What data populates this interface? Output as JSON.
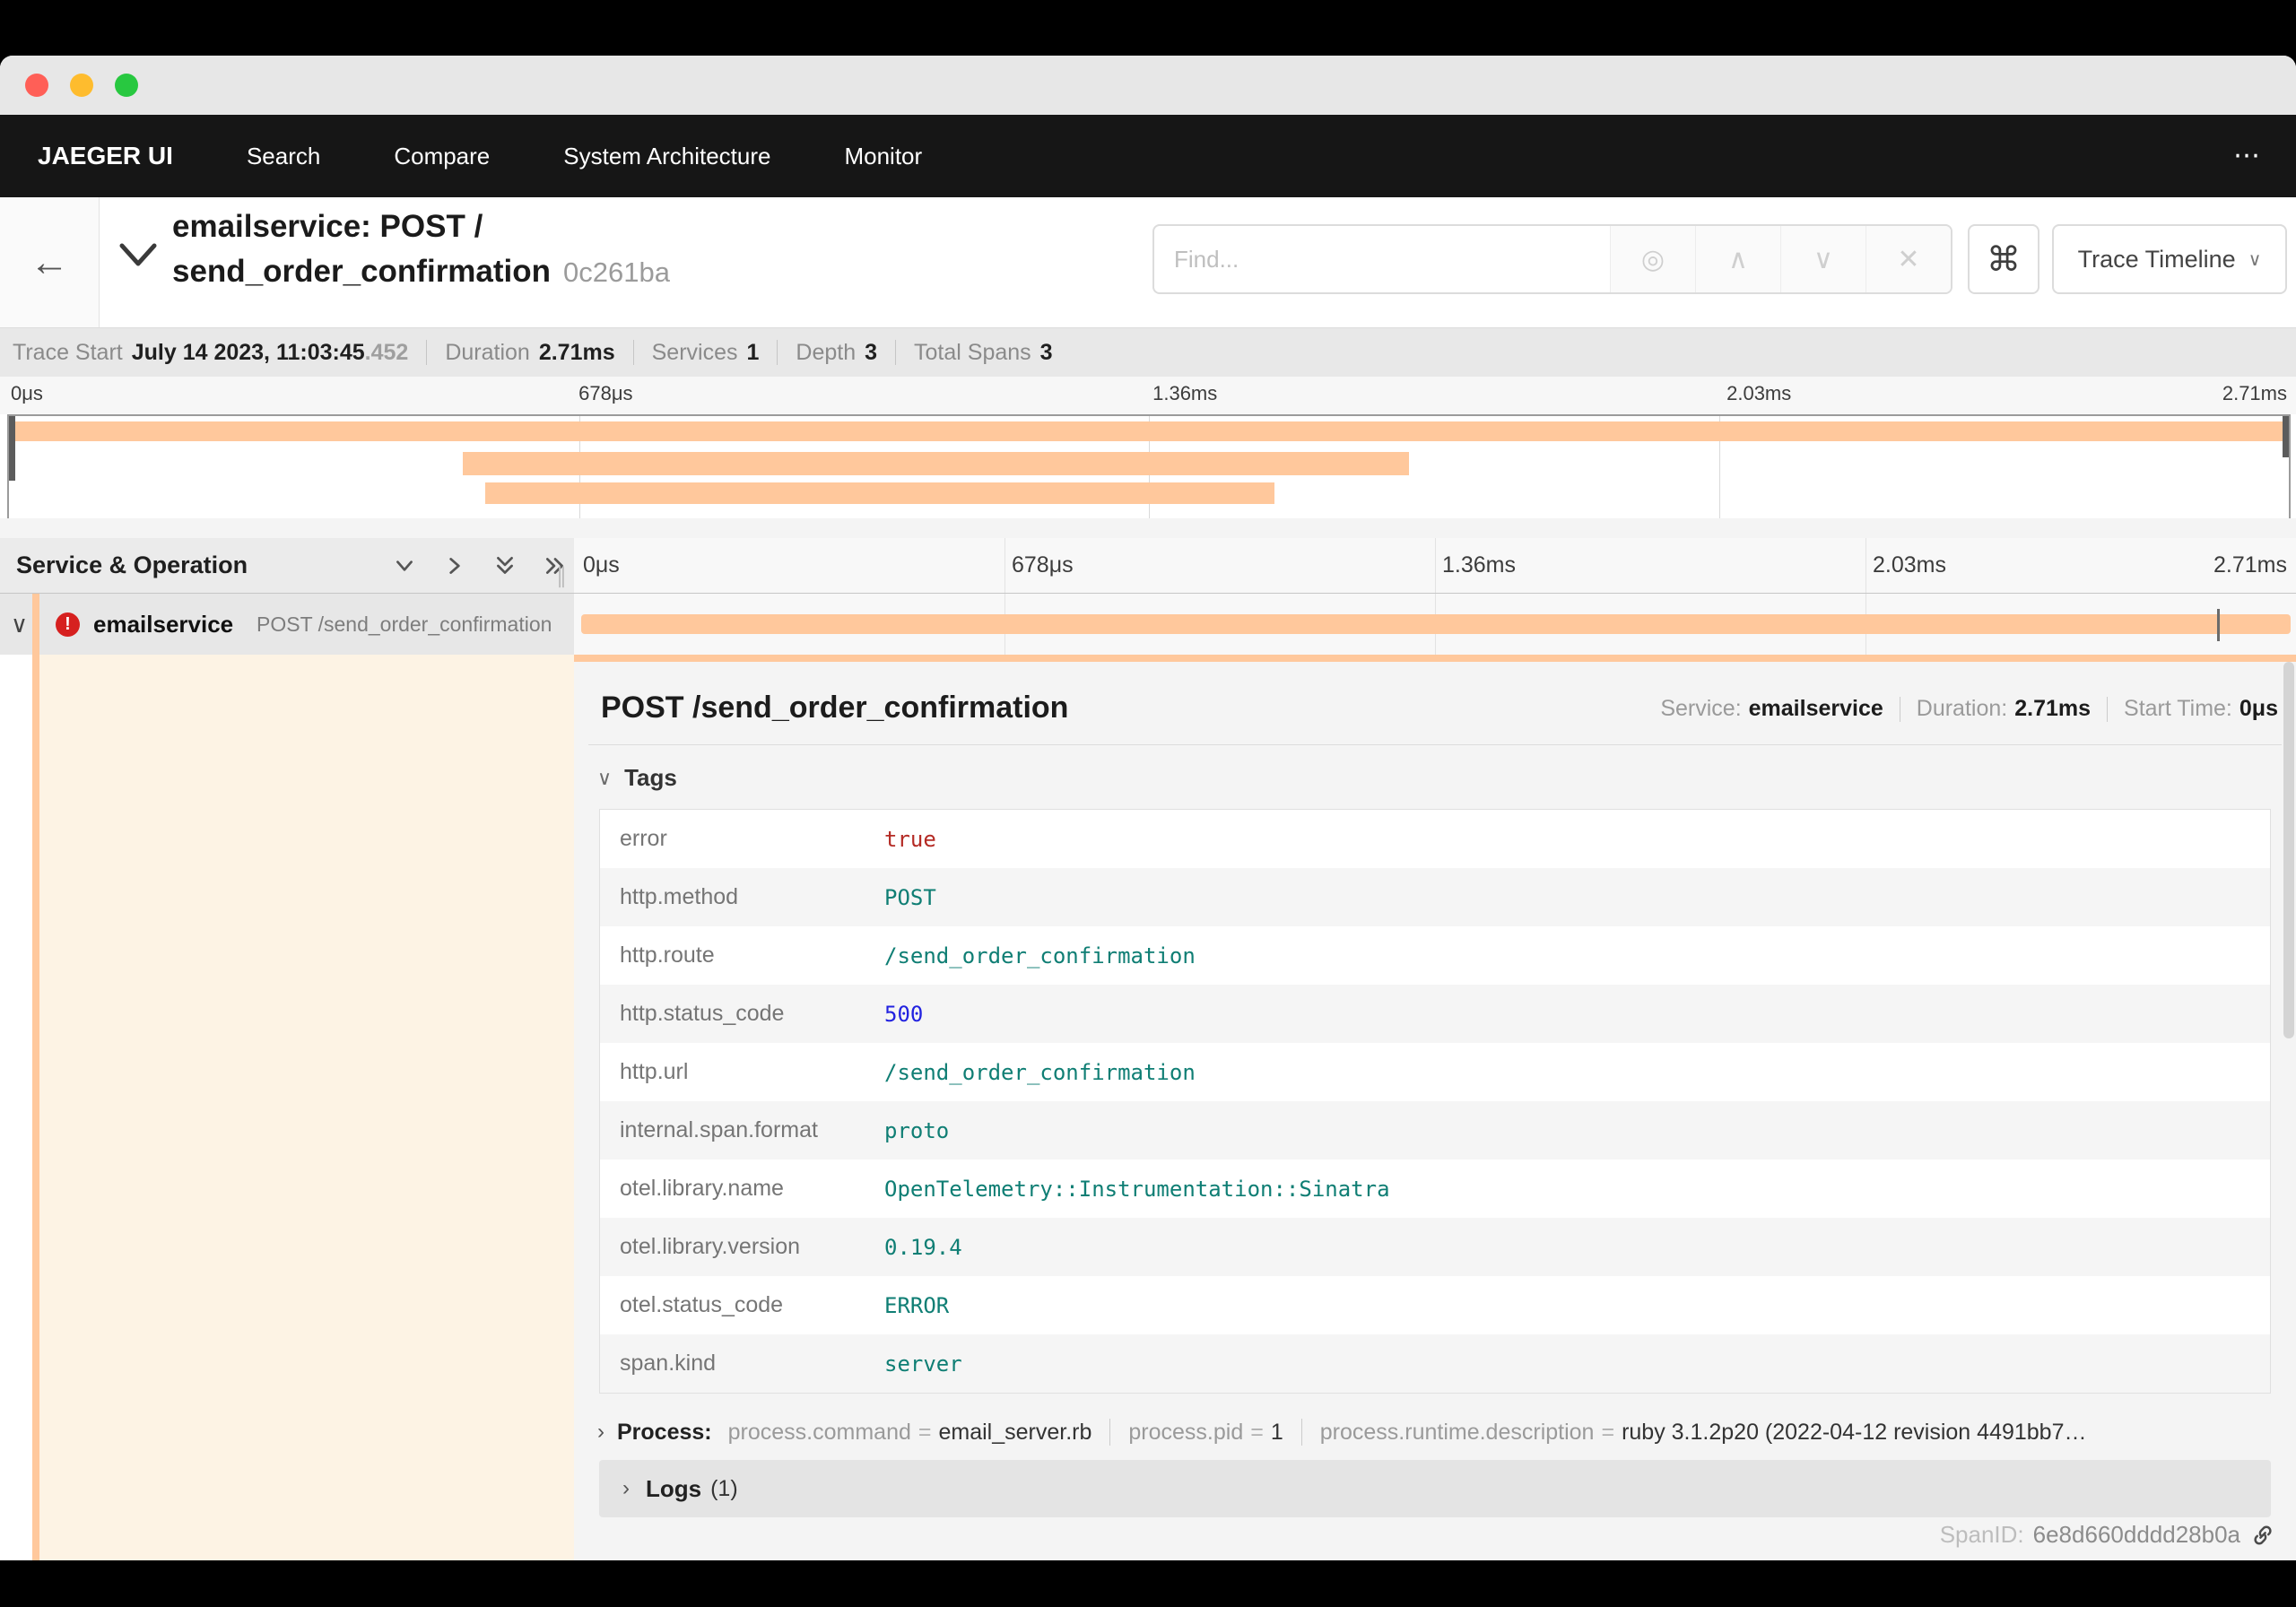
{
  "window": {
    "traffic_light_colors": {
      "close": "#ff5f57",
      "minimize": "#febc2e",
      "zoom": "#28c840"
    }
  },
  "navbar": {
    "brand": "JAEGER UI",
    "items": [
      "Search",
      "Compare",
      "System Architecture",
      "Monitor"
    ],
    "overflow": "⋯"
  },
  "trace_header": {
    "back_arrow": "←",
    "title_line1": "emailservice: POST /",
    "title_line2": "send_order_confirmation",
    "trace_id": "0c261ba",
    "find_placeholder": "Find...",
    "find_icons": {
      "locate": "◎",
      "prev": "∧",
      "next": "∨",
      "clear": "✕"
    },
    "shortcut_label": "⌘",
    "view_selector": "Trace Timeline",
    "view_caret": "∨"
  },
  "trace_summary": [
    {
      "label": "Trace Start",
      "value": "July 14 2023, 11:03:45",
      "suffix": ".452"
    },
    {
      "label": "Duration",
      "value": "2.71ms"
    },
    {
      "label": "Services",
      "value": "1"
    },
    {
      "label": "Depth",
      "value": "3"
    },
    {
      "label": "Total Spans",
      "value": "3"
    }
  ],
  "timeline": {
    "ticks": [
      "0μs",
      "678μs",
      "1.36ms",
      "2.03ms",
      "2.71ms"
    ],
    "span_color": "#FFC89C",
    "minimap_spans": [
      {
        "left_pct": 0.2,
        "width_pct": 99.6
      },
      {
        "left_pct": 19.9,
        "width_pct": 41.5
      },
      {
        "left_pct": 20.9,
        "width_pct": 34.6
      }
    ],
    "log_marker": {
      "left_pct": 95.4
    }
  },
  "span_table": {
    "header_left": "Service & Operation",
    "row": {
      "collapse_chevron": "∨",
      "error_glyph": "!",
      "service": "emailservice",
      "operation": "POST /send_order_confirmation"
    }
  },
  "detail": {
    "title": "POST /send_order_confirmation",
    "meta": [
      {
        "label": "Service:",
        "value": "emailservice"
      },
      {
        "label": "Duration:",
        "value": "2.71ms"
      },
      {
        "label": "Start Time:",
        "value": "0μs"
      }
    ],
    "tags_header": "Tags",
    "tags": [
      {
        "key": "error",
        "value": "true",
        "color": "#b42a24"
      },
      {
        "key": "http.method",
        "value": "POST",
        "color": "#0f7e74"
      },
      {
        "key": "http.route",
        "value": "/send_order_confirmation",
        "color": "#0f7e74"
      },
      {
        "key": "http.status_code",
        "value": "500",
        "color": "#2222e0"
      },
      {
        "key": "http.url",
        "value": "/send_order_confirmation",
        "color": "#0f7e74"
      },
      {
        "key": "internal.span.format",
        "value": "proto",
        "color": "#0f7e74"
      },
      {
        "key": "otel.library.name",
        "value": "OpenTelemetry::Instrumentation::Sinatra",
        "color": "#0f7e74"
      },
      {
        "key": "otel.library.version",
        "value": "0.19.4",
        "color": "#0f7e74"
      },
      {
        "key": "otel.status_code",
        "value": "ERROR",
        "color": "#0f7e74"
      },
      {
        "key": "span.kind",
        "value": "server",
        "color": "#0f7e74"
      }
    ],
    "process": {
      "label": "Process:",
      "items": [
        {
          "key": "process.command",
          "value": "email_server.rb"
        },
        {
          "key": "process.pid",
          "value": "1"
        },
        {
          "key": "process.runtime.description",
          "value": "ruby 3.1.2p20 (2022-04-12 revision 4491bb7…"
        }
      ]
    },
    "logs": {
      "label": "Logs",
      "count": "(1)"
    },
    "span_id_label": "SpanID:",
    "span_id": "6e8d660dddd28b0a"
  }
}
